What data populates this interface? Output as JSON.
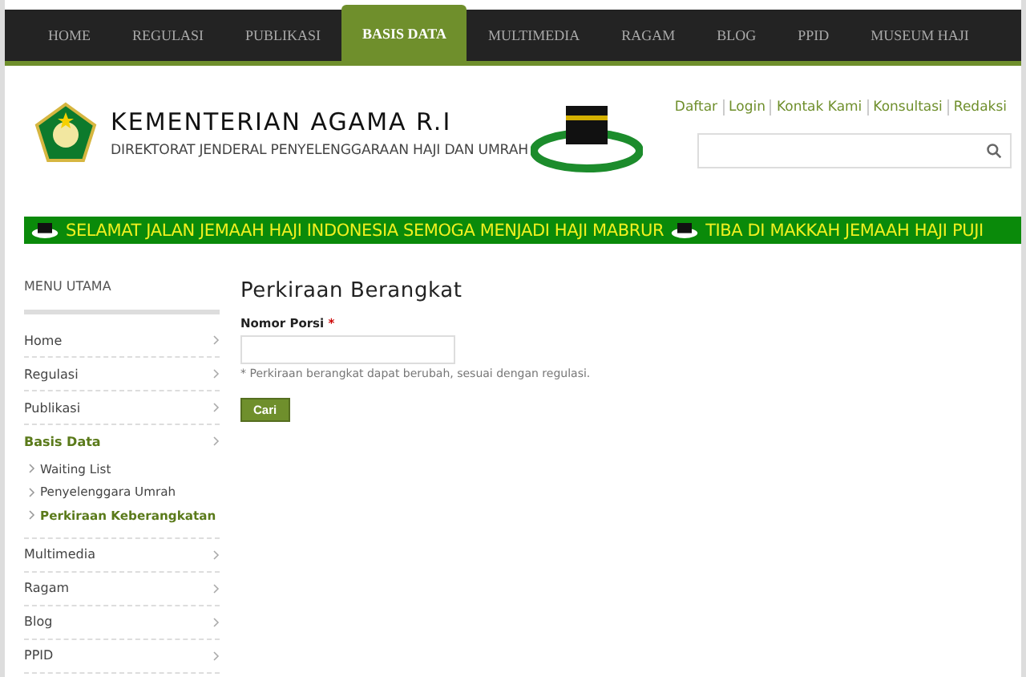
{
  "nav": [
    {
      "label": "HOME",
      "selected": false
    },
    {
      "label": "REGULASI",
      "selected": false
    },
    {
      "label": "PUBLIKASI",
      "selected": false
    },
    {
      "label": "BASIS DATA",
      "selected": true
    },
    {
      "label": "MULTIMEDIA",
      "selected": false
    },
    {
      "label": "RAGAM",
      "selected": false
    },
    {
      "label": "BLOG",
      "selected": false
    },
    {
      "label": "PPID",
      "selected": false
    },
    {
      "label": "MUSEUM HAJI",
      "selected": false
    }
  ],
  "header": {
    "title": "KEMENTERIAN AGAMA R.I",
    "subtitle": "DIREKTORAT JENDERAL PENYELENGGARAAN HAJI DAN UMRAH",
    "links": [
      "Daftar",
      "Login",
      "Kontak Kami",
      "Konsultasi",
      "Redaksi"
    ]
  },
  "ticker": [
    "SELAMAT JALAN JEMAAH HAJI INDONESIA SEMOGA MENJADI HAJI MABRUR",
    "TIBA DI MAKKAH JEMAAH HAJI PUJI"
  ],
  "sidebar": {
    "title": "MENU UTAMA",
    "items": [
      {
        "label": "Home",
        "selected": false
      },
      {
        "label": "Regulasi",
        "selected": false
      },
      {
        "label": "Publikasi",
        "selected": false
      },
      {
        "label": "Basis Data",
        "selected": true,
        "children": [
          {
            "label": "Waiting List",
            "selected": false
          },
          {
            "label": "Penyelenggara Umrah",
            "selected": false
          },
          {
            "label": "Perkiraan Keberangkatan",
            "selected": true
          }
        ]
      },
      {
        "label": "Multimedia",
        "selected": false
      },
      {
        "label": "Ragam",
        "selected": false
      },
      {
        "label": "Blog",
        "selected": false
      },
      {
        "label": "PPID",
        "selected": false
      }
    ]
  },
  "form": {
    "title": "Perkiraan Berangkat",
    "label": "Nomor Porsi",
    "required": "*",
    "note": "* Perkiraan berangkat dapat berubah, sesuai dengan regulasi.",
    "button": "Cari"
  }
}
